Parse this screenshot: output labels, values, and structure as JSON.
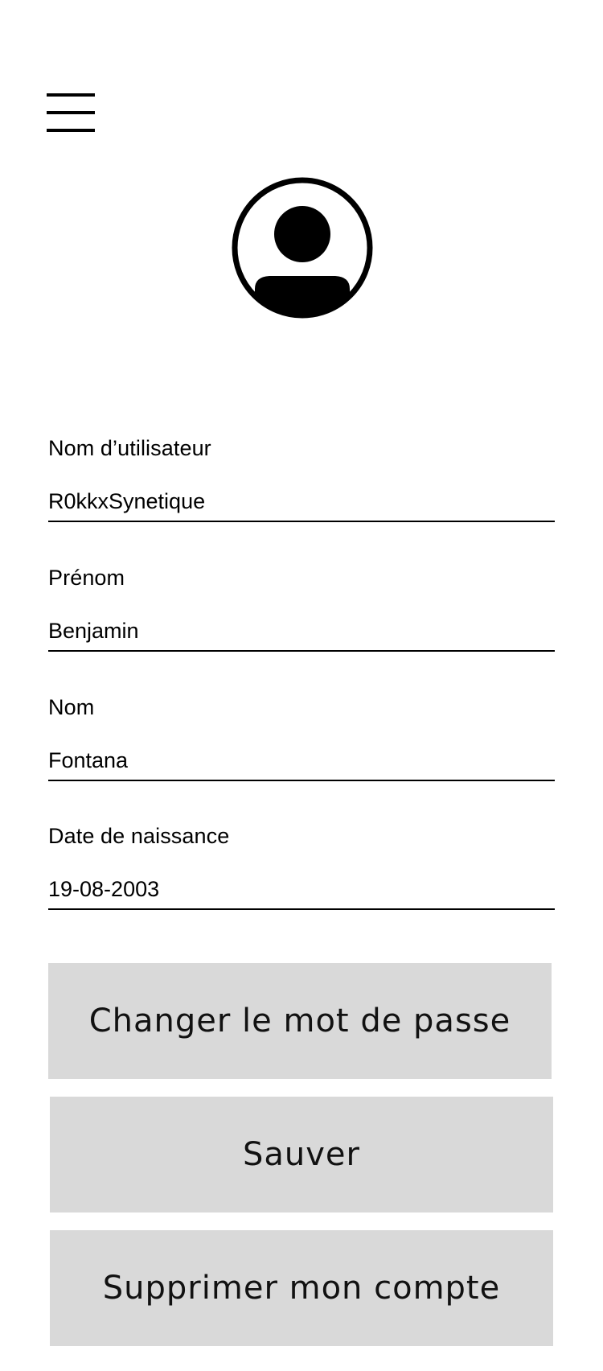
{
  "header": {
    "menu_icon": "hamburger-menu-icon",
    "avatar_icon": "user-profile-icon"
  },
  "form": {
    "username": {
      "label": "Nom d’utilisateur",
      "value": "R0kkxSynetique"
    },
    "first_name": {
      "label": "Prénom",
      "value": "Benjamin"
    },
    "last_name": {
      "label": "Nom",
      "value": "Fontana"
    },
    "birth_date": {
      "label": "Date de naissance",
      "value": "19-08-2003"
    }
  },
  "actions": {
    "change_password_label": "Changer le mot de passe",
    "save_label": "Sauver",
    "delete_account_label": "Supprimer mon compte"
  },
  "colors": {
    "background": "#ffffff",
    "button_background": "#d9d9d9",
    "text": "#000000"
  }
}
